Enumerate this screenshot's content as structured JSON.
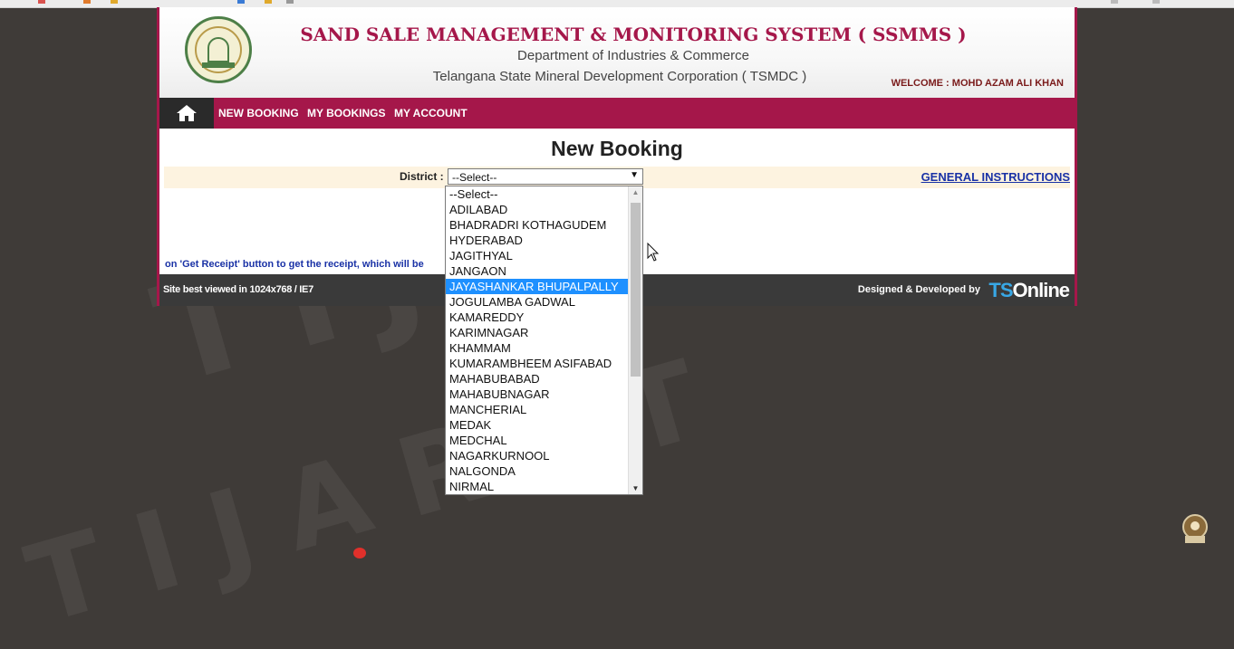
{
  "header": {
    "title": "SAND SALE MANAGEMENT & MONITORING SYSTEM ( SSMMS )",
    "department": "Department of Industries & Commerce",
    "corporation": "Telangana State Mineral Development Corporation ( TSMDC )",
    "welcome": "WELCOME : MOHD AZAM ALI KHAN"
  },
  "nav": {
    "items": [
      "NEW BOOKING",
      "MY BOOKINGS",
      "MY ACCOUNT"
    ]
  },
  "main": {
    "title": "New Booking",
    "district_label": "District :",
    "select_value": "--Select--",
    "general_instructions": "GENERAL INSTRUCTIONS",
    "receipt_note": "on 'Get Receipt' button to get the receipt, which will be"
  },
  "dropdown": {
    "options": [
      "--Select--",
      "ADILABAD",
      "BHADRADRI KOTHAGUDEM",
      "HYDERABAD",
      "JAGITHYAL",
      "JANGAON",
      "JAYASHANKAR BHUPALPALLY",
      "JOGULAMBA GADWAL",
      "KAMAREDDY",
      "KARIMNAGAR",
      "KHAMMAM",
      "KUMARAMBHEEM ASIFABAD",
      "MAHABUBABAD",
      "MAHABUBNAGAR",
      "MANCHERIAL",
      "MEDAK",
      "MEDCHAL",
      "NAGARKURNOOL",
      "NALGONDA",
      "NIRMAL"
    ],
    "highlighted": "JAYASHANKAR BHUPALPALLY"
  },
  "footer": {
    "left": "Site best viewed in 1024x768 / IE7",
    "right": "Designed & Developed by",
    "brand_ts": "TS",
    "brand_rest": "Online"
  },
  "watermark": "TIJARAT",
  "icons": {
    "home": "home-icon",
    "emblem": "telangana-emblem-icon",
    "cursor": "mouse-pointer-icon",
    "corner_logo": "channel-logo-icon"
  },
  "colors": {
    "brand": "#a5174a",
    "link": "#1a32a6",
    "highlight": "#1e90ff",
    "row_bg": "#fdf3e0"
  }
}
